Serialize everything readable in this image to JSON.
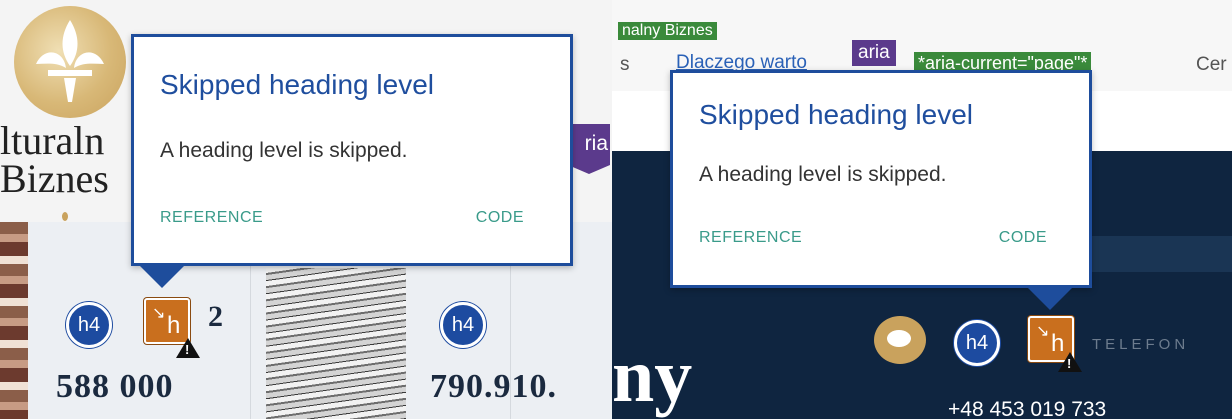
{
  "left": {
    "brand_lines": "lturaln\nBiznes",
    "stat_number_1": "588 000",
    "stat_number_2": "790.910.",
    "badge_h4": "h4",
    "badge_skip_letter": "h",
    "badge_count": "2",
    "aria_chip": "ria"
  },
  "right": {
    "green_chip_top": "nalny Biznes",
    "nav_s": "s",
    "nav_link": "Dlaczego warto",
    "aria_chip": "aria",
    "aria_current": "*aria-current=\"page\"*",
    "nav_cen": "Cer",
    "big_text": "ny",
    "telefon_label": "TELEFON",
    "phone_number": "+48 453 019 733",
    "badge_h4": "h4",
    "badge_skip_letter": "h"
  },
  "popup": {
    "title": "Skipped heading level",
    "body": "A heading level is skipped.",
    "reference_label": "REFERENCE",
    "code_label": "CODE"
  },
  "colors": {
    "accent_blue": "#1e4d9c",
    "link_teal": "#3a9b8a",
    "skip_orange": "#c96f1e",
    "aria_purple": "#5b3a8c",
    "chip_green": "#3a8a3b",
    "gold": "#c9a25d"
  },
  "icons": [
    "fleur-logo-icon",
    "heading-h4-icon",
    "skipped-heading-icon",
    "warning-icon",
    "chat-bubble-icon"
  ]
}
